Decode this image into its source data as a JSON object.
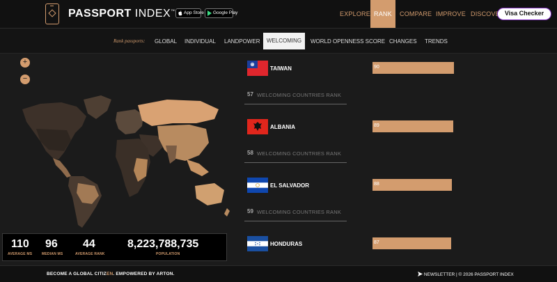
{
  "header": {
    "logo": {
      "bold": "PASSPORT",
      "light": " INDEX",
      "tm": "™"
    },
    "app_store": "App Store",
    "google_play": "Google Play",
    "nav": [
      "EXPLORE",
      "RANK",
      "COMPARE",
      "IMPROVE",
      "DISCOVE"
    ],
    "visa_checker": "Visa Checker"
  },
  "subnav": {
    "label": "Rank passports:",
    "items": [
      "GLOBAL",
      "INDIVIDUAL",
      "LANDPOWER",
      "WELCOMING",
      "WORLD OPENNESS SCORE",
      "CHANGES",
      "TRENDS"
    ]
  },
  "map": {
    "zoom_in": "+",
    "zoom_out": "−"
  },
  "stats": [
    {
      "value": "110",
      "label": "AVERAGE MS"
    },
    {
      "value": "96",
      "label": "MEDIAN MS"
    },
    {
      "value": "44",
      "label": "AVERAGE RANK"
    },
    {
      "value": "8,223,788,735",
      "label": "POPULATION"
    }
  ],
  "ranking": {
    "entries": [
      {
        "country": "TAIWAN",
        "score": 90,
        "flag_icon": "flag-taiwan-icon"
      },
      {
        "country": "ALBANIA",
        "score": 89,
        "flag_icon": "flag-albania-icon"
      },
      {
        "country": "EL SALVADOR",
        "score": 88,
        "flag_icon": "flag-el-salvador-icon"
      },
      {
        "country": "HONDURAS",
        "score": 87,
        "flag_icon": "flag-honduras-icon"
      }
    ],
    "ranks": [
      {
        "num": "57",
        "label": "WELCOMING COUNTRIES RANK"
      },
      {
        "num": "58",
        "label": "WELCOMING COUNTRIES RANK"
      },
      {
        "num": "59",
        "label": "WELCOMING COUNTRIES RANK"
      }
    ]
  },
  "footer": {
    "left_a": "BECOME A GLOBAL CITIZ",
    "left_b": "EN",
    "left_c": ".   EMPOWERED BY ",
    "left_d": "ARTON",
    "left_e": ".",
    "right": "NEWSLETTER  |  © 2026 PASSPORT INDEX"
  },
  "colors": {
    "accent": "#d39c6e",
    "background": "#1b1b1b",
    "visa_border": "#7e2bbd"
  }
}
